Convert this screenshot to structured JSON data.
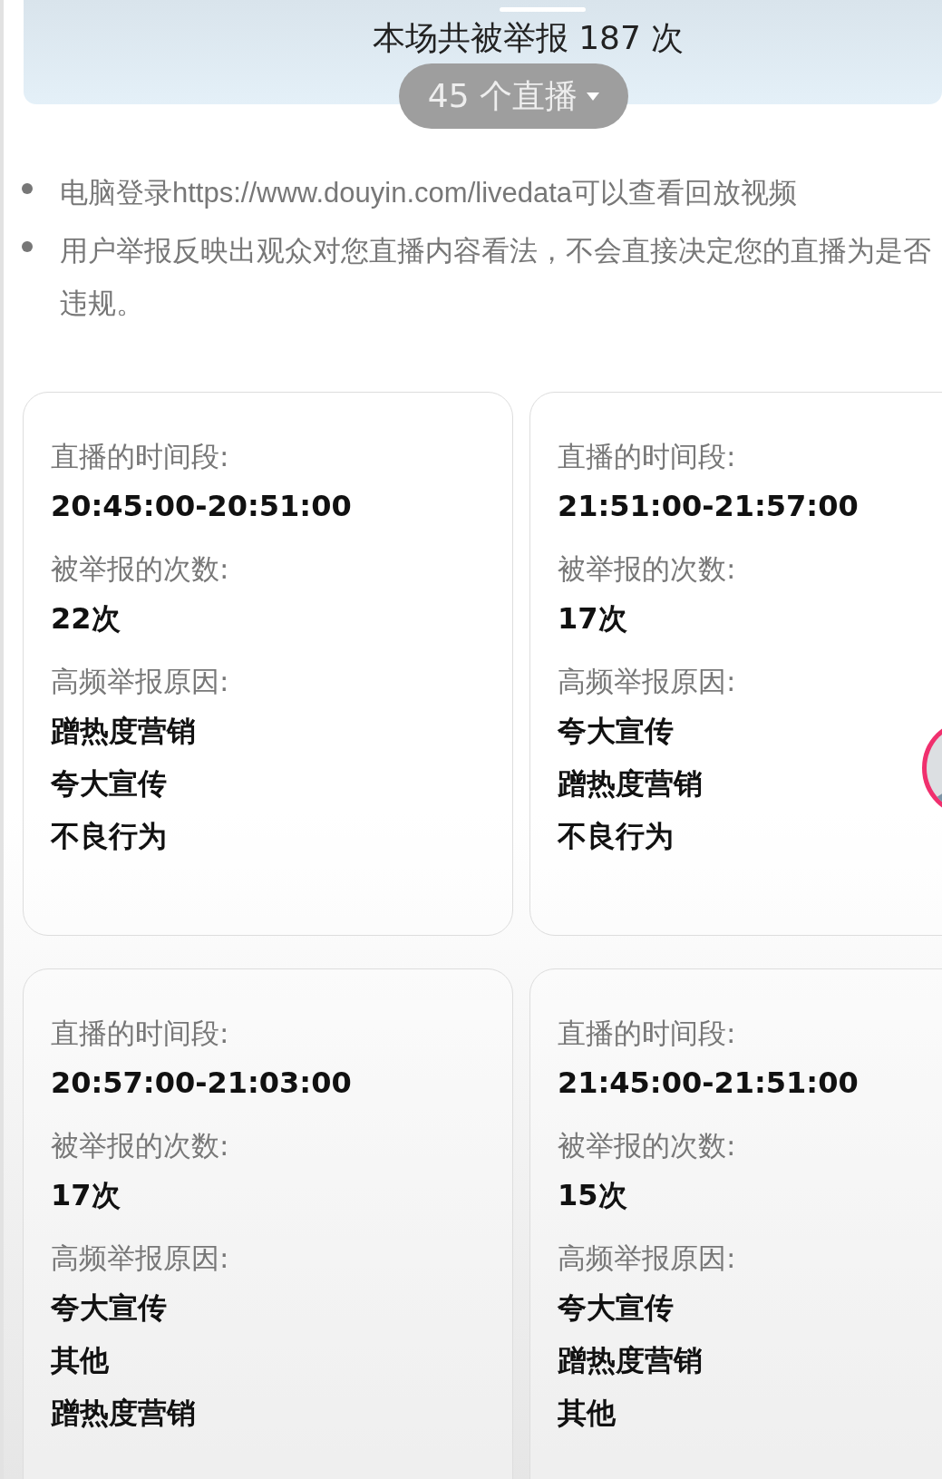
{
  "header": {
    "title": "本场共被举报 187 次",
    "stream_selector": "45 个直播"
  },
  "notes": [
    "电脑登录https://www.douyin.com/livedata可以查看回放视频",
    "用户举报反映出观众对您直播内容看法，不会直接决定您的直播为是否违规。"
  ],
  "cards": [
    {
      "time_label": "直播的时间段:",
      "time": "20:45:00-20:51:00",
      "count_label": "被举报的次数:",
      "count": "22次",
      "reasons_label": "高频举报原因:",
      "reasons": [
        "蹭热度营销",
        "夸大宣传",
        "不良行为"
      ]
    },
    {
      "time_label": "直播的时间段:",
      "time": "21:51:00-21:57:00",
      "count_label": "被举报的次数:",
      "count": "17次",
      "reasons_label": "高频举报原因:",
      "reasons": [
        "夸大宣传",
        "蹭热度营销",
        "不良行为"
      ]
    },
    {
      "time_label": "直播的时间段:",
      "time": "20:57:00-21:03:00",
      "count_label": "被举报的次数:",
      "count": "17次",
      "reasons_label": "高频举报原因:",
      "reasons": [
        "夸大宣传",
        "其他",
        "蹭热度营销"
      ]
    },
    {
      "time_label": "直播的时间段:",
      "time": "21:45:00-21:51:00",
      "count_label": "被举报的次数:",
      "count": "15次",
      "reasons_label": "高频举报原因:",
      "reasons": [
        "夸大宣传",
        "蹭热度营销",
        "其他"
      ]
    }
  ]
}
